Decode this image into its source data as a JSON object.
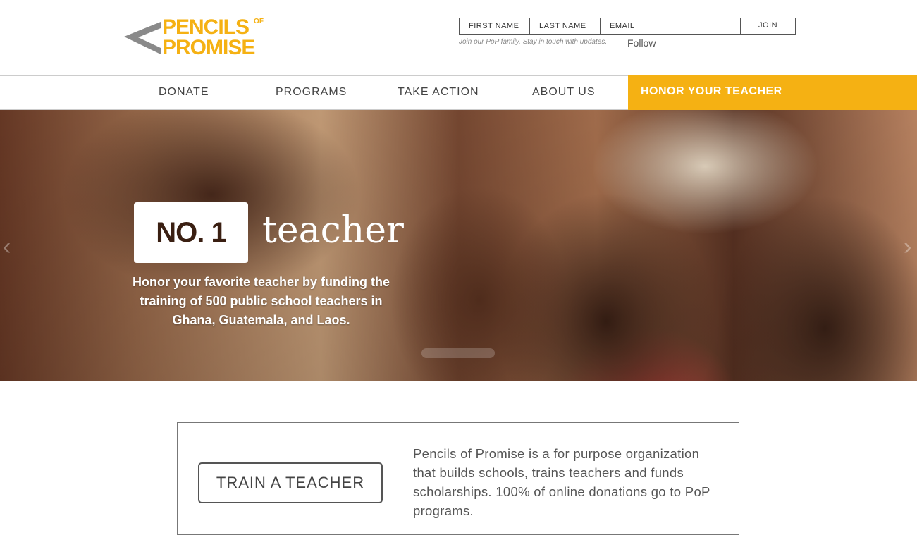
{
  "header": {
    "logo": {
      "word_top": "PENCILS",
      "word_of": "OF",
      "word_bottom": "PROMISE",
      "brand_color": "#f5b113"
    },
    "signup": {
      "first_name_placeholder": "FIRST NAME",
      "last_name_placeholder": "LAST NAME",
      "email_placeholder": "EMAIL",
      "join_label": "JOIN",
      "tagline": "Join our PoP family. Stay in touch with updates.",
      "follow_label": "Follow"
    }
  },
  "nav": {
    "items": [
      {
        "label": "DONATE"
      },
      {
        "label": "PROGRAMS"
      },
      {
        "label": "TAKE ACTION"
      },
      {
        "label": "ABOUT US"
      }
    ],
    "highlight": {
      "label": "HONOR YOUR TEACHER",
      "color": "#f5b113"
    }
  },
  "hero": {
    "badge": "NO. 1",
    "word": "teacher",
    "text": "Honor your favorite teacher by funding the training of 500 public school teachers in Ghana, Guatemala, and Laos.",
    "prev_icon": "chevron-left-icon",
    "next_icon": "chevron-right-icon"
  },
  "intro": {
    "button_label": "TRAIN A TEACHER",
    "description": "Pencils of Promise is a for purpose organization that builds schools, trains teachers and funds scholarships. 100% of online donations go to PoP programs."
  }
}
